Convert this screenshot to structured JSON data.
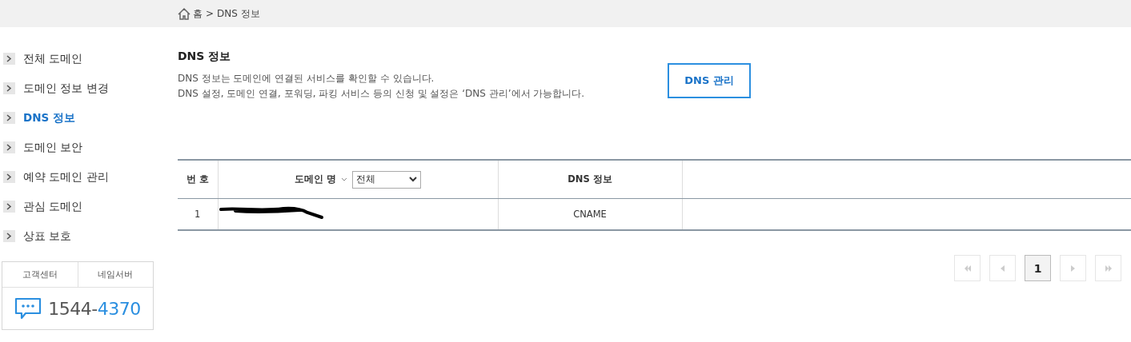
{
  "breadcrumb": {
    "home": "홈",
    "separator": ">",
    "current": "DNS 정보"
  },
  "sidebar": {
    "items": [
      {
        "label": "전체 도메인",
        "selected": false
      },
      {
        "label": "도메인 정보 변경",
        "selected": false
      },
      {
        "label": "DNS 정보",
        "selected": true
      },
      {
        "label": "도메인 보안",
        "selected": false
      },
      {
        "label": "예약 도메인 관리",
        "selected": false
      },
      {
        "label": "관심 도메인",
        "selected": false
      },
      {
        "label": "상표 보호",
        "selected": false
      }
    ]
  },
  "support": {
    "tabs": [
      "고객센터",
      "네임서버"
    ],
    "phone_prefix": "1544-",
    "phone_suffix": "4370"
  },
  "page": {
    "title": "DNS 정보",
    "description": [
      "DNS 정보는 도메인에 연결된 서비스를 확인할 수 있습니다.",
      "DNS 설정, 도메인 연결, 포워딩, 파킹 서비스 등의 신청 및 설정은 ‘DNS 관리’에서 가능합니다."
    ],
    "button": "DNS 관리"
  },
  "table": {
    "columns": {
      "number": "번 호",
      "domain": "도메인 명",
      "filter": "전체",
      "dns": "DNS 정보"
    },
    "rows": [
      {
        "number": "1",
        "dns": "CNAME",
        "redacted": true
      }
    ]
  },
  "pagination": {
    "pages": [
      {
        "label": "1",
        "selected": true
      }
    ]
  }
}
